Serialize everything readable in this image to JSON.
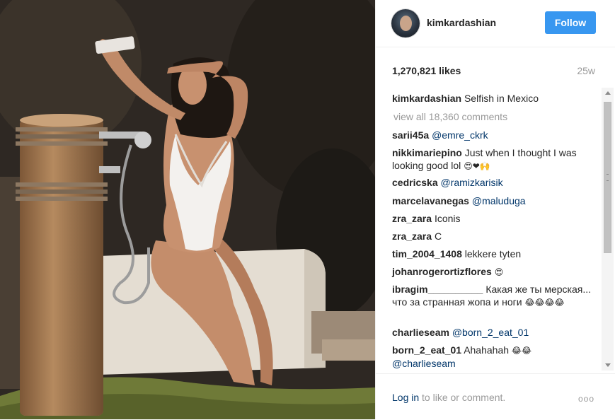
{
  "post": {
    "username": "kimkardashian",
    "follow_label": "Follow",
    "likes": "1,270,821 likes",
    "age": "25w",
    "caption_user": "kimkardashian",
    "caption_text": "Selfish in Mexico",
    "view_all": "view all 18,360 comments"
  },
  "comments": [
    {
      "user": "sarii45a",
      "mention": "@emre_ckrk",
      "text": "",
      "emoji": ""
    },
    {
      "user": "nikkimariepino",
      "mention": "",
      "text": "Just when I thought I was looking good lol",
      "emoji": "😍❤🙌"
    },
    {
      "user": "cedricska",
      "mention": "@ramizkarisik",
      "text": "",
      "emoji": ""
    },
    {
      "user": "marcelavanegas",
      "mention": "@maluduga",
      "text": "",
      "emoji": ""
    },
    {
      "user": "zra_zara",
      "mention": "",
      "text": "Iconis",
      "emoji": ""
    },
    {
      "user": "zra_zara",
      "mention": "",
      "text": "C",
      "emoji": ""
    },
    {
      "user": "tim_2004_1408",
      "mention": "",
      "text": "lekkere tyten",
      "emoji": ""
    },
    {
      "user": "johanrogerortizflores",
      "mention": "",
      "text": "",
      "emoji": "😍"
    },
    {
      "user": "ibragim__________",
      "mention": "",
      "text": "Какая же ты мерская... что за странная жопа и ноги",
      "emoji": "😂😂😂😂"
    },
    {
      "user": "charlieseam",
      "mention": "@born_2_eat_01",
      "text": "",
      "emoji": ""
    },
    {
      "user": "born_2_eat_01",
      "mention": "@charlieseam",
      "text": "Ahahahah",
      "emoji": "😂😂"
    }
  ],
  "footer": {
    "login_link": "Log in",
    "login_rest": " to like or comment.",
    "more_label": "ooo"
  },
  "icons": {
    "avatar": "profile-avatar",
    "more": "more-options-icon",
    "scroll_up": "scroll-up-arrow-icon",
    "scroll_down": "scroll-down-arrow-icon"
  },
  "colors": {
    "follow_button": "#3897f0",
    "link": "#003569",
    "muted": "#999999"
  }
}
